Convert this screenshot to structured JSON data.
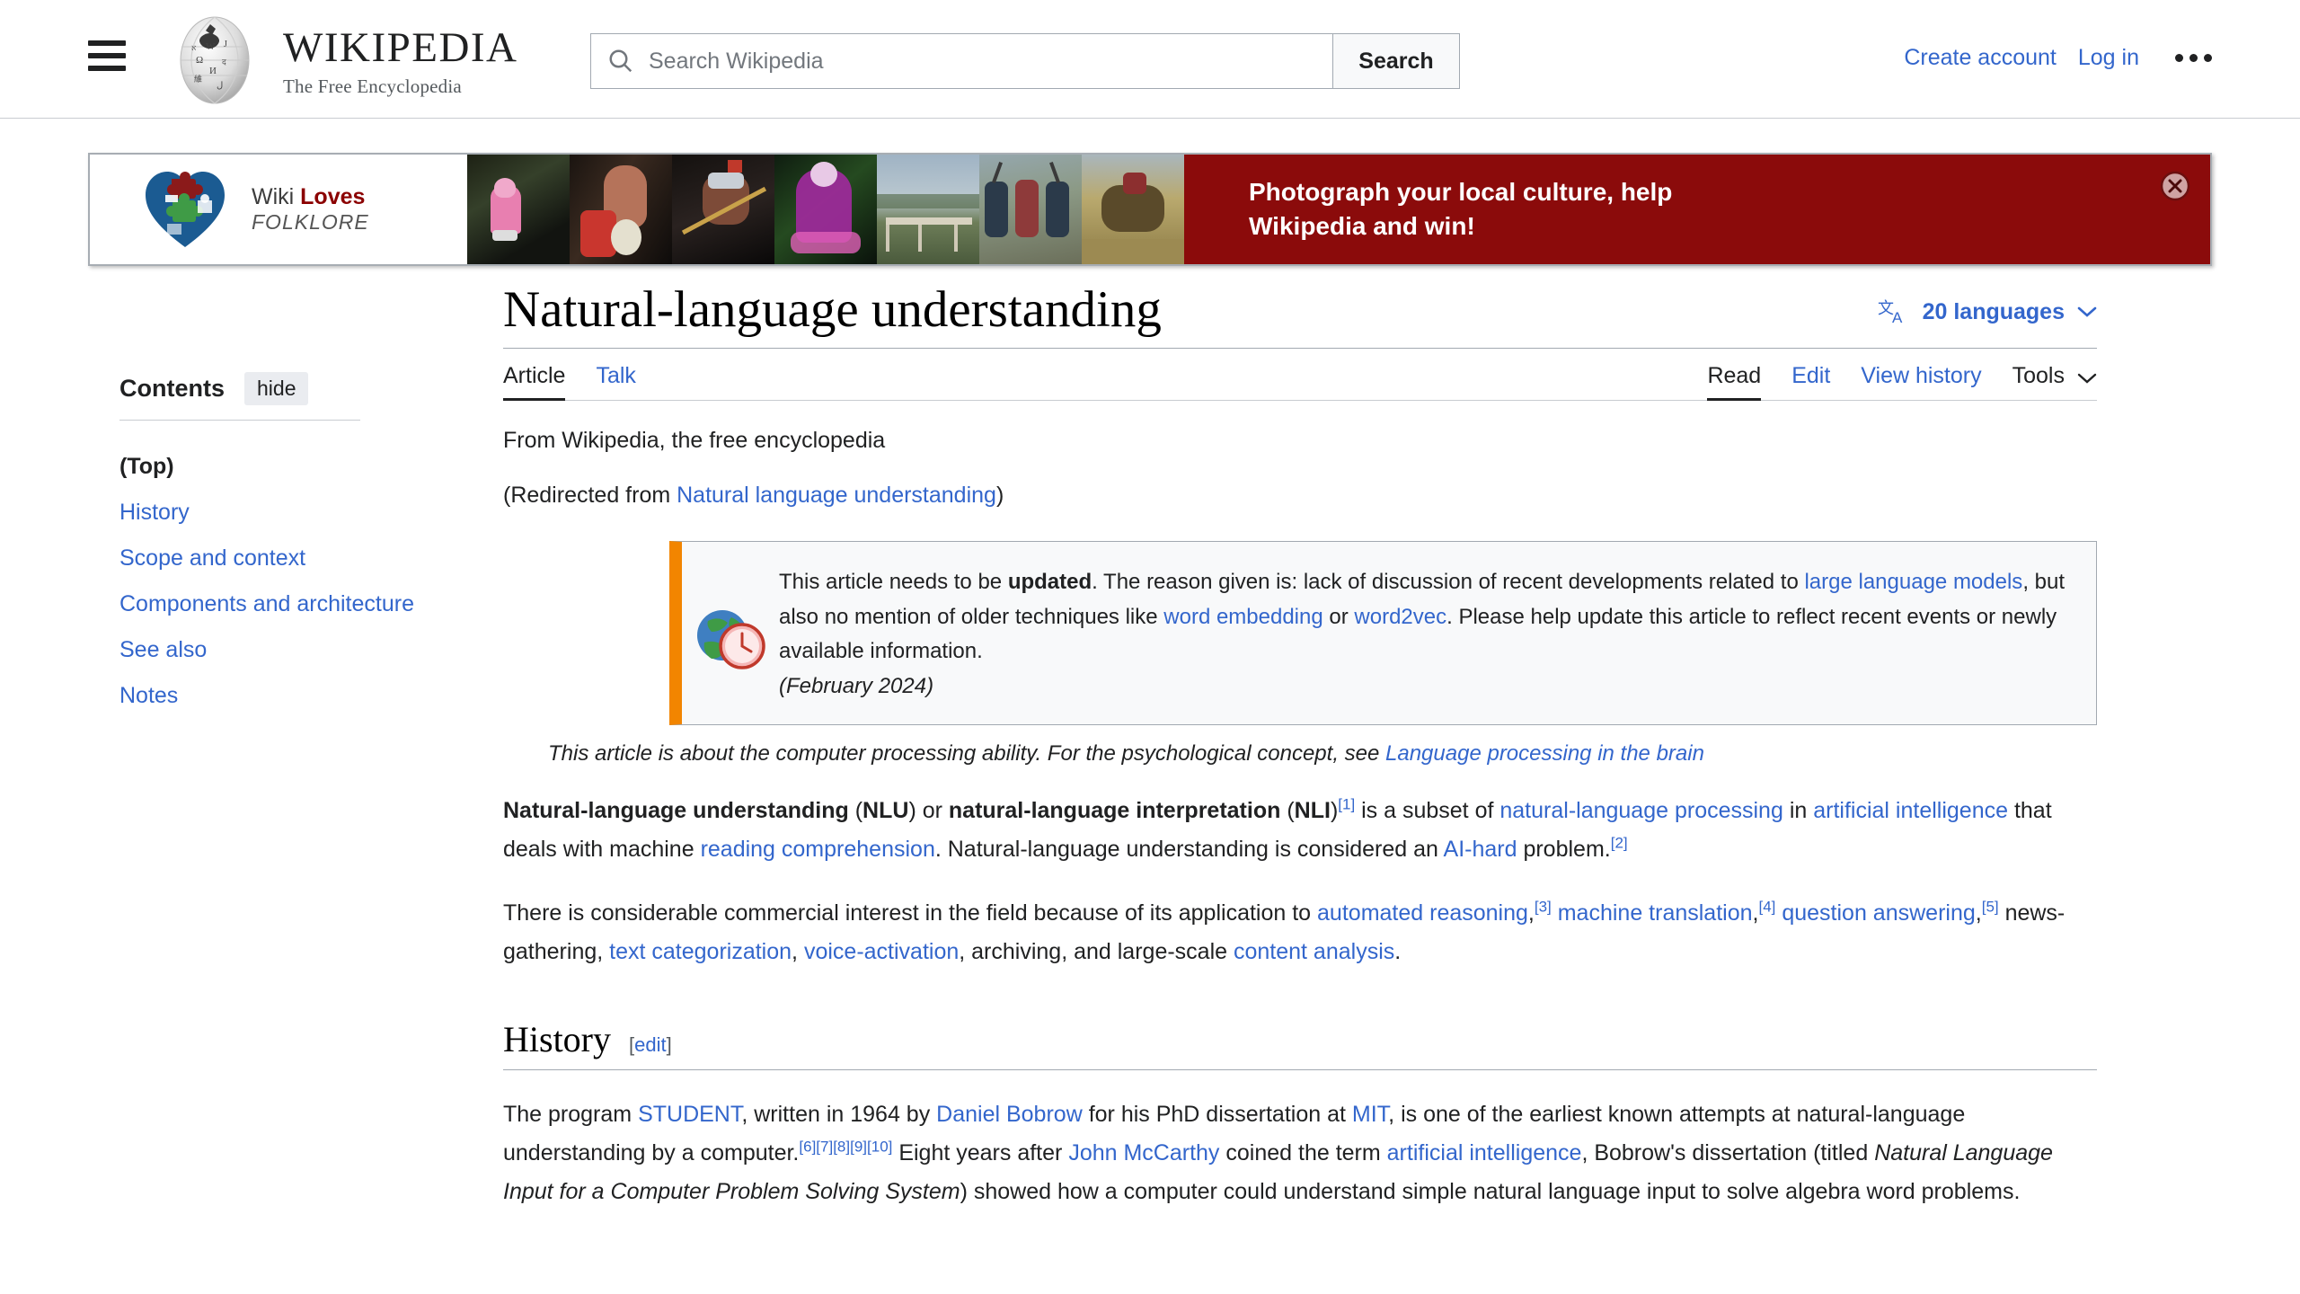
{
  "header": {
    "menu_icon": "hamburger-icon",
    "logo_title": "WIKIPEDIA",
    "logo_subtitle": "The Free Encyclopedia",
    "search": {
      "placeholder": "Search Wikipedia",
      "value": "",
      "button_label": "Search",
      "icon": "search-icon"
    },
    "create_account": "Create account",
    "log_in": "Log in",
    "more_icon": "ellipsis-icon"
  },
  "banner": {
    "campaign_line1_prefix": "Wiki ",
    "campaign_line1_bold": "Loves",
    "campaign_line2": "FOLKLORE",
    "message": "Photograph your local culture, help Wikipedia and win!",
    "close_icon": "close-circle-icon",
    "bg_color": "#8b0b0b"
  },
  "sidebar": {
    "title": "Contents",
    "hide_label": "hide",
    "items": [
      {
        "label": "(Top)",
        "active": true
      },
      {
        "label": "History",
        "active": false
      },
      {
        "label": "Scope and context",
        "active": false
      },
      {
        "label": "Components and architecture",
        "active": false
      },
      {
        "label": "See also",
        "active": false
      },
      {
        "label": "Notes",
        "active": false
      }
    ]
  },
  "article": {
    "title": "Natural-language understanding",
    "language_icon": "language-translate-icon",
    "language_label": "20 languages",
    "language_chevron": "chevron-down-icon",
    "tabs_left": [
      {
        "label": "Article",
        "active": true
      },
      {
        "label": "Talk",
        "active": false
      }
    ],
    "tabs_right": [
      {
        "label": "Read",
        "active": true
      },
      {
        "label": "Edit",
        "active": false
      },
      {
        "label": "View history",
        "active": false
      },
      {
        "label": "Tools",
        "active": false,
        "plain": true
      }
    ],
    "tools_chevron": "chevron-down-icon",
    "from_line": "From Wikipedia, the free encyclopedia",
    "redirect_prefix": "(Redirected from ",
    "redirect_link": "Natural language understanding",
    "redirect_suffix": ")",
    "notice": {
      "icon": "globe-clock-icon",
      "t1": "This article needs to be ",
      "bold1": "updated",
      "t2": ". The reason given is: lack of discussion of recent developments related to ",
      "link1": "large language models",
      "t3": ", but also no mention of older techniques like ",
      "link2": "word embedding",
      "t4": " or ",
      "link3": "word2vec",
      "t5": ". Please help update this article to reflect recent events or newly available information.",
      "date": "(February 2024)"
    },
    "hatnote": {
      "text": "This article is about the computer processing ability. For the psychological concept, see ",
      "link": "Language processing in the brain"
    },
    "lead": {
      "b1": "Natural-language understanding",
      "p1": " (",
      "b2": "NLU",
      "p2": ") or ",
      "b3": "natural-language interpretation",
      "p3": " (",
      "b4": "NLI",
      "p4": ")",
      "ref1": "[1]",
      "p5": " is a subset of ",
      "l1": "natural-language processing",
      "p6": " in ",
      "l2": "artificial intelligence",
      "p7": " that deals with machine ",
      "l3": "reading comprehension",
      "p8": ". Natural-language understanding is considered an ",
      "l4": "AI-hard",
      "p9": " problem.",
      "ref2": "[2]"
    },
    "para2": {
      "t1": "There is considerable commercial interest in the field because of its application to ",
      "l1": "automated reasoning",
      "t2": ",",
      "ref1": "[3]",
      "t3": " ",
      "l2": "machine translation",
      "t4": ",",
      "ref2": "[4]",
      "t5": " ",
      "l3": "question answering",
      "t6": ",",
      "ref3": "[5]",
      "t7": " news-gathering, ",
      "l4": "text categorization",
      "t8": ", ",
      "l5": "voice-activation",
      "t9": ", archiving, and large-scale ",
      "l6": "content analysis",
      "t10": "."
    },
    "history": {
      "heading": "History",
      "edit_open": "[",
      "edit_label": "edit",
      "edit_close": "]",
      "t1": "The program ",
      "l1": "STUDENT",
      "t2": ", written in 1964 by ",
      "l2": "Daniel Bobrow",
      "t3": " for his PhD dissertation at ",
      "l3": "MIT",
      "t4": ", is one of the earliest known attempts at natural-language understanding by a computer.",
      "ref1": "[6]",
      "ref2": "[7]",
      "ref3": "[8]",
      "ref4": "[9]",
      "ref5": "[10]",
      "t5": " Eight years after ",
      "l4": "John McCarthy",
      "t6": " coined the term ",
      "l5": "artificial intelligence",
      "t7": ", Bobrow's dissertation (titled ",
      "i1": "Natural Language Input for a Computer Problem Solving System",
      "t8": ") showed how a computer could understand simple natural language input to solve algebra word problems."
    }
  },
  "colors": {
    "link": "#3366cc",
    "text": "#202122",
    "notice_accent": "#f28500",
    "banner_red": "#8b0b0b"
  }
}
